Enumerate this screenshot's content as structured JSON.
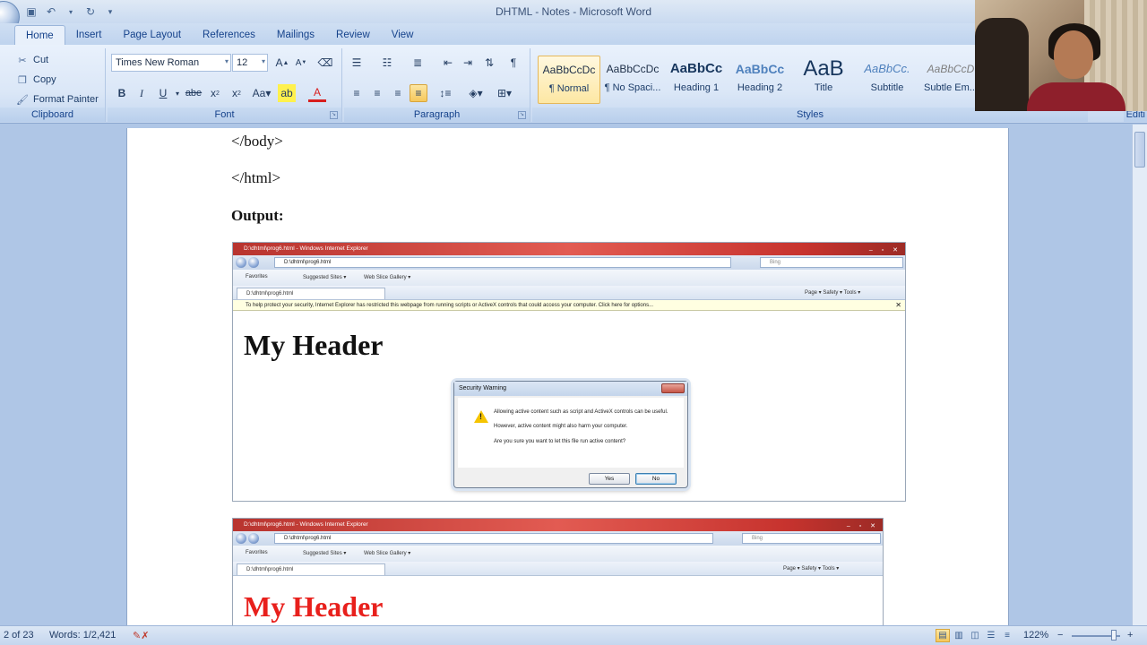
{
  "window": {
    "title": "DHTML - Notes - Microsoft Word"
  },
  "tabs": [
    {
      "label": "Home",
      "active": true
    },
    {
      "label": "Insert"
    },
    {
      "label": "Page Layout"
    },
    {
      "label": "References"
    },
    {
      "label": "Mailings"
    },
    {
      "label": "Review"
    },
    {
      "label": "View"
    }
  ],
  "ribbon": {
    "clipboard": {
      "label": "Clipboard",
      "cut": "Cut",
      "copy": "Copy",
      "format_painter": "Format Painter"
    },
    "font": {
      "label": "Font",
      "family": "Times New Roman",
      "size": "12"
    },
    "paragraph": {
      "label": "Paragraph"
    },
    "styles": {
      "label": "Styles",
      "edit": "Editi",
      "items": [
        {
          "sample": "AaBbCcDc",
          "name": "¶ Normal",
          "selected": true
        },
        {
          "sample": "AaBbCcDc",
          "name": "¶ No Spaci..."
        },
        {
          "sample": "AaBbCc",
          "name": "Heading 1"
        },
        {
          "sample": "AaBbCc",
          "name": "Heading 2"
        },
        {
          "sample": "AaB",
          "name": "Title"
        },
        {
          "sample": "AaBbCc.",
          "name": "Subtitle"
        },
        {
          "sample": "AaBbCcD",
          "name": "Subtle Em..."
        }
      ]
    }
  },
  "document": {
    "lines": [
      "</body>",
      "</html>",
      "Output:"
    ],
    "screenshot1": {
      "title": "D:\\dhtml\\prog6.html - Windows Internet Explorer",
      "url": "D:\\dhtml\\prog6.html",
      "search": "Bing",
      "favorites": "Favorites",
      "suggested": "Suggested Sites ▾",
      "webslice": "Web Slice Gallery ▾",
      "tab": "D:\\dhtml\\prog6.html",
      "tools": "Page ▾   Safety ▾   Tools ▾",
      "infobar": "To help protect your security, Internet Explorer has restricted this webpage from running scripts or ActiveX controls that could access your computer. Click here for options...",
      "header": "My Header",
      "dialog": {
        "title": "Security Warning",
        "line1": "Allowing active content such as script and ActiveX controls can be useful.",
        "line2": "However, active content might also harm your computer.",
        "line3": "Are you sure you want to let this file run active content?",
        "yes": "Yes",
        "no": "No"
      }
    },
    "screenshot2": {
      "title": "D:\\dhtml\\prog6.html - Windows Internet Explorer",
      "url": "D:\\dhtml\\prog6.html",
      "search": "Bing",
      "favorites": "Favorites",
      "suggested": "Suggested Sites ▾",
      "webslice": "Web Slice Gallery ▾",
      "tab": "D:\\dhtml\\prog6.html",
      "tools": "Page ▾   Safety ▾   Tools ▾",
      "header": "My Header",
      "header_color": "#e8201c"
    }
  },
  "status": {
    "page": "2 of 23",
    "words": "Words: 1/2,421",
    "zoom": "122%",
    "zoom_out": "−",
    "zoom_in": "+"
  }
}
